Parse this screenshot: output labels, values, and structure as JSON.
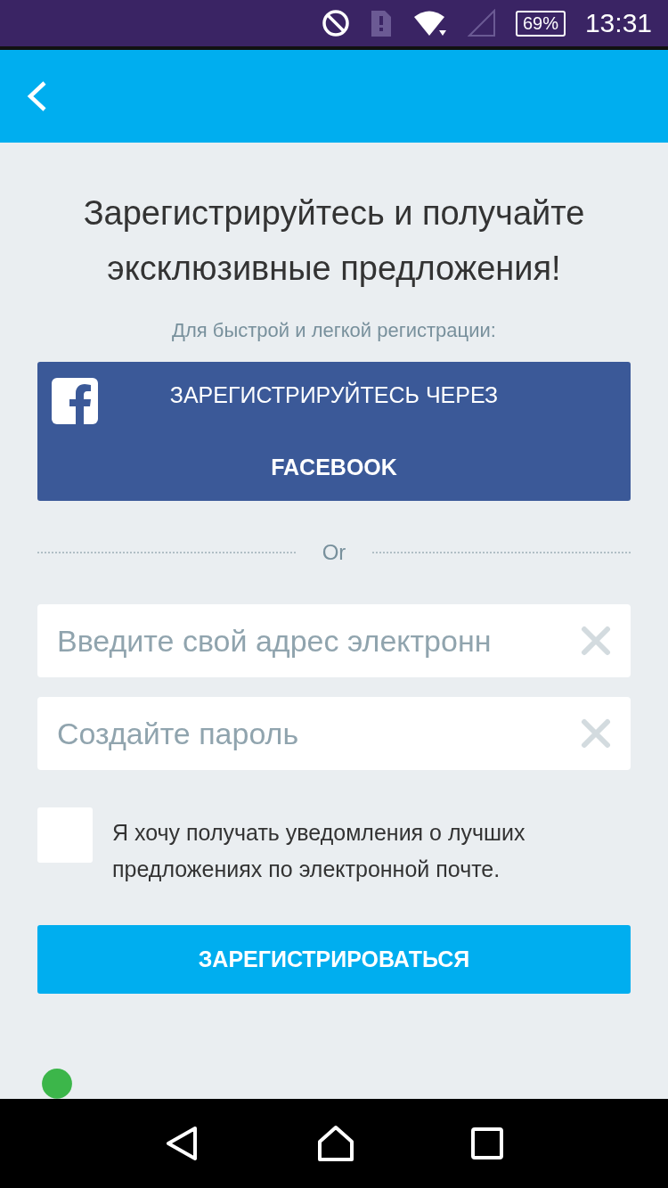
{
  "status_bar": {
    "battery": "69%",
    "time": "13:31"
  },
  "heading": "Зарегистрируйтесь и получайте эксклюзивные предложения!",
  "subheading": "Для быстрой и легкой регистрации:",
  "facebook_button": {
    "line_1": "ЗАРЕГИСТРИРУЙТЕСЬ ЧЕРЕЗ",
    "line_2": "FACEBOOK"
  },
  "divider_label": "Or",
  "fields": [
    {
      "placeholder": "Введите свой адрес электронн"
    },
    {
      "placeholder": "Создайте пароль"
    }
  ],
  "newsletter": {
    "label": "Я хочу получать уведомления о лучших предложениях по электронной почте.",
    "checked": false
  },
  "submit_button": "ЗАРЕГИСТРИРОВАТЬСЯ"
}
